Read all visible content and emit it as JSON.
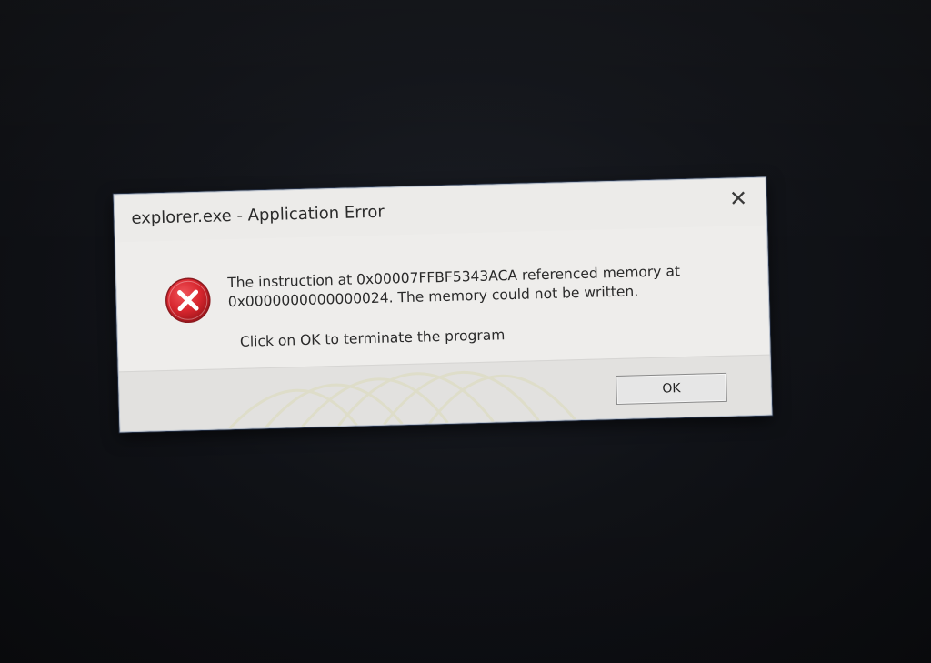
{
  "dialog": {
    "title": "explorer.exe - Application Error",
    "message_line_1": "The instruction at 0x00007FFBF5343ACA referenced memory at",
    "message_line_2": "0x0000000000000024. The memory could not be written.",
    "instruction": "Click on OK to terminate the program",
    "ok_label": "OK",
    "close_glyph": "✕",
    "icon": "error-icon"
  },
  "colors": {
    "background": "#111318",
    "dialog_body": "#eeedeb",
    "footer": "#e2e1df",
    "error_red": "#d7262e",
    "text": "#2a2a2a"
  }
}
